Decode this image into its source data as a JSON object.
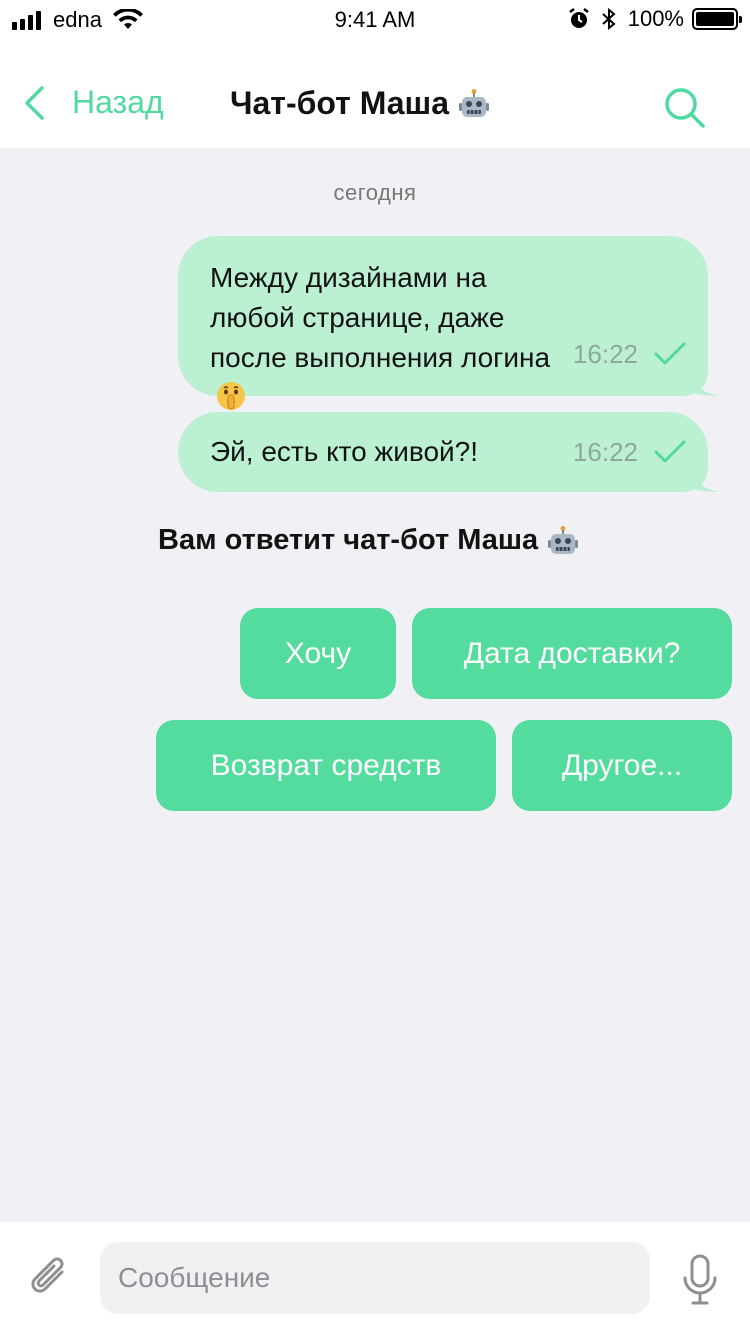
{
  "status_bar": {
    "carrier": "edna",
    "time": "9:41 AM",
    "battery": "100%"
  },
  "nav": {
    "back_label": "Назад",
    "title": "Чат-бот Маша",
    "title_icon": "robot-icon",
    "search_icon": "search-icon"
  },
  "chat": {
    "date": "сегодня",
    "messages": [
      {
        "text": "Между дизайнами на любой странице, даже после выполнения логина",
        "emoji": "shushing-face-icon",
        "time": "16:22",
        "status": "sent-check"
      },
      {
        "text": "Эй, есть кто живой?!",
        "time": "16:22",
        "status": "sent-check"
      }
    ],
    "bot_notice": "Вам ответит чат-бот Маша",
    "bot_notice_icon": "robot-icon",
    "quick_replies": [
      "Хочу",
      "Дата доставки?",
      "Возврат средств",
      "Другое..."
    ]
  },
  "input": {
    "placeholder": "Сообщение",
    "value": "",
    "attach_icon": "paperclip-icon",
    "mic_icon": "microphone-icon"
  },
  "colors": {
    "accent": "#52D9A0",
    "button": "#54DB9E",
    "bubble": "#BCF0D3",
    "background": "#F1F0F5"
  }
}
